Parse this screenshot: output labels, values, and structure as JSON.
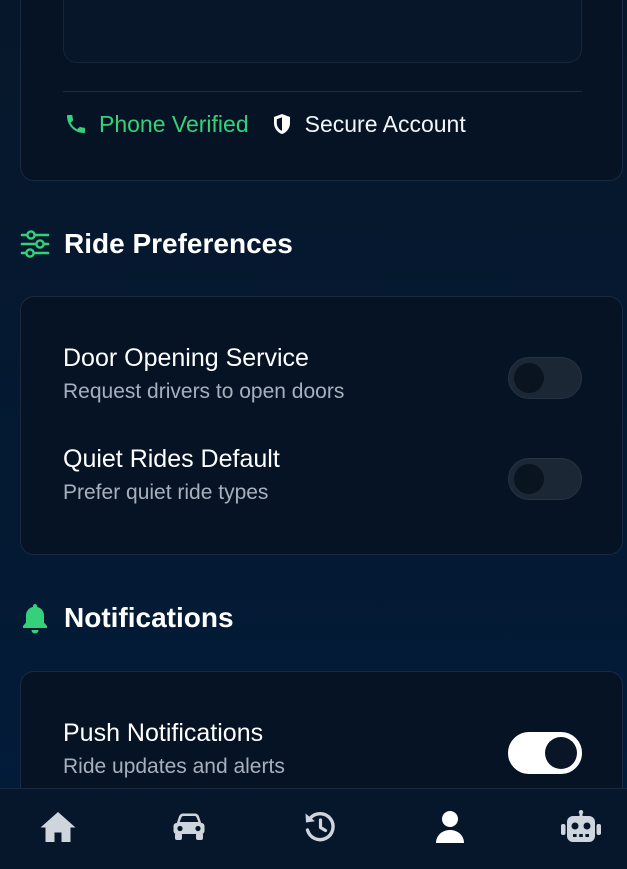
{
  "account": {
    "phone_verified_label": "Phone Verified",
    "secure_account_label": "Secure Account"
  },
  "ride_preferences": {
    "title": "Ride Preferences",
    "items": [
      {
        "title": "Door Opening Service",
        "subtitle": "Request drivers to open doors",
        "enabled": false
      },
      {
        "title": "Quiet Rides Default",
        "subtitle": "Prefer quiet ride types",
        "enabled": false
      }
    ]
  },
  "notifications": {
    "title": "Notifications",
    "items": [
      {
        "title": "Push Notifications",
        "subtitle": "Ride updates and alerts",
        "enabled": true
      }
    ]
  },
  "bottom_nav": {
    "items": [
      {
        "icon": "home-icon"
      },
      {
        "icon": "car-icon"
      },
      {
        "icon": "history-icon"
      },
      {
        "icon": "user-icon",
        "active": true
      },
      {
        "icon": "robot-icon"
      }
    ]
  },
  "colors": {
    "background": "#041a33",
    "card": "#061325",
    "accent_green": "#34d17a",
    "muted_text": "#a7b0bd"
  }
}
